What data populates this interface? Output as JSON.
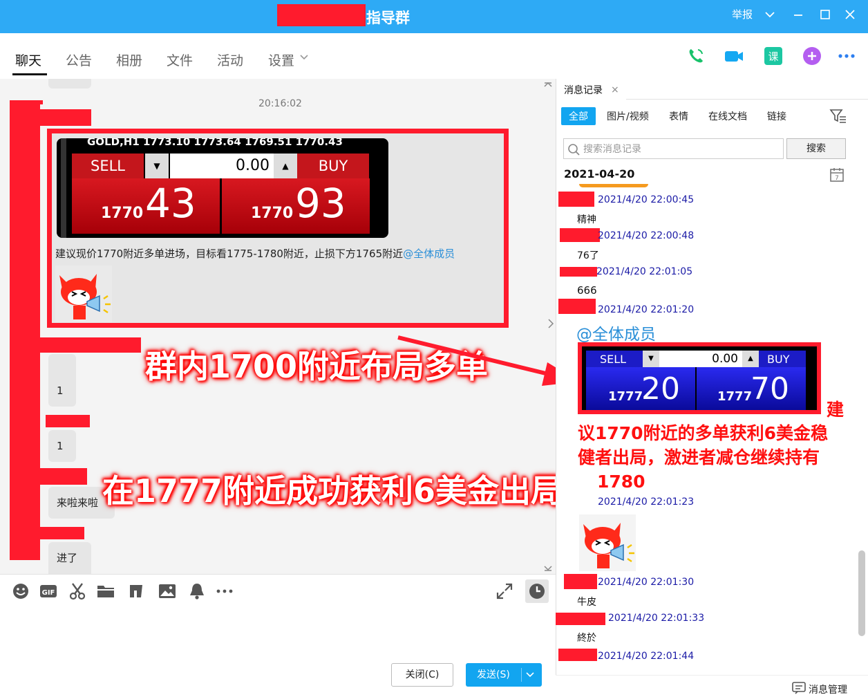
{
  "window": {
    "title": "指导群",
    "report": "举报"
  },
  "tabs": [
    {
      "label": "聊天"
    },
    {
      "label": "公告"
    },
    {
      "label": "相册"
    },
    {
      "label": "文件"
    },
    {
      "label": "活动"
    },
    {
      "label": "设置"
    }
  ],
  "chat": {
    "timestamp": "20:16:02",
    "mt_card": {
      "header": "GOLD,H1  1773.10 1773.64 1769.51 1770.43",
      "sell": "SELL",
      "buy": "BUY",
      "volume": "0.00",
      "bid_small": "1770",
      "bid_big": "43",
      "ask_small": "1770",
      "ask_big": "93"
    },
    "suggestion": "建议现价1770附近多单进场，目标看1775-1780附近，止损下方1765附近",
    "mention": "@全体成员",
    "bubbles": [
      "1",
      "1",
      "来啦来啦",
      "进了"
    ],
    "annot1": "群内1700附近布局多单",
    "annot2": "在1777附近成功获利6美金出局"
  },
  "actions": {
    "close": "关闭(C)",
    "send": "发送(S)"
  },
  "history": {
    "tab_title": "消息记录",
    "filters": [
      "全部",
      "图片/视频",
      "表情",
      "在线文档",
      "链接"
    ],
    "search_placeholder": "搜索消息记录",
    "search_button": "搜索",
    "date": "2021-04-20",
    "entries": [
      {
        "time": "2021/4/20 22:00:45",
        "text": "精神"
      },
      {
        "time": "2021/4/20 22:00:48",
        "text": "76了"
      },
      {
        "time": "2021/4/20 22:01:05",
        "text": "666"
      },
      {
        "time": "2021/4/20 22:01:20",
        "text": "@全体成员"
      },
      {
        "time": "2021/4/20 22:01:23",
        "text": ""
      },
      {
        "time": "2021/4/20 22:01:30",
        "text": "牛皮"
      },
      {
        "time": "2021/4/20 22:01:33",
        "text": "終於"
      },
      {
        "time": "2021/4/20 22:01:44",
        "text": ""
      }
    ],
    "mt_card2": {
      "sell": "SELL",
      "buy": "BUY",
      "volume": "0.00",
      "bid_small": "1777",
      "bid_big": "20",
      "ask_small": "1777",
      "ask_big": "70"
    },
    "note_lines": [
      "建",
      "议1770附近的多单获利6美金稳",
      "健者出局，激进者减仓继续持有",
      "1780"
    ],
    "manage": "消息管理"
  },
  "colors": {
    "accent": "#12a5f0",
    "titlebar": "#2eaaf5",
    "annotation_red": "#ff1b2d"
  }
}
